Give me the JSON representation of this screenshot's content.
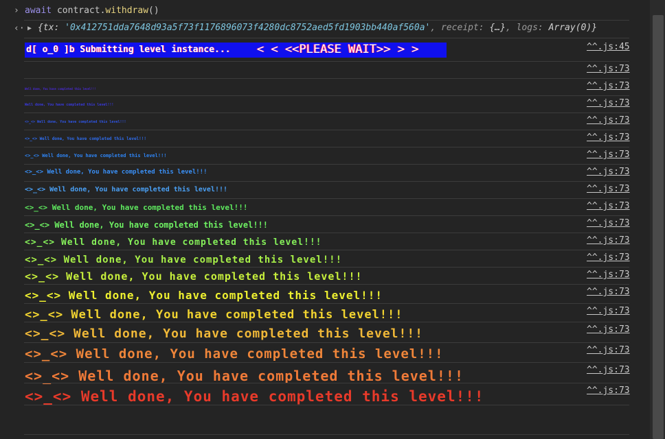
{
  "command": {
    "keyword": "await",
    "object": "contract",
    "method": "withdraw",
    "suffix": "()"
  },
  "result": {
    "open": "{tx: ",
    "tx": "'0x412751dda7648d93a5f73f1176896073f4280dc8752aed5fd1903bb440af560a'",
    "receipt_key": ", receipt: ",
    "receipt": "{…}",
    "logs_key": ", logs: ",
    "logs": "Array(0)",
    "close": "}"
  },
  "banner": {
    "left": "d[ o_0 ]b Submitting level instance...",
    "right": "<  < <<PLEASE WAIT>> >  >",
    "source": "^^.js:45"
  },
  "messages": [
    {
      "text": "",
      "source": "^^.js:73",
      "color": "#5a2ad0"
    },
    {
      "text": "Well done, You have completed this level!!!",
      "source": "^^.js:73",
      "color": "#4a2ad8"
    },
    {
      "text": "Well done, You have completed this level!!!",
      "source": "^^.js:73",
      "color": "#3a3ae0"
    },
    {
      "text": "<>_<> Well done, You have completed this level!!!",
      "source": "^^.js:73",
      "color": "#2f55e6"
    },
    {
      "text": "<>_<> Well done, You have completed this level!!!",
      "source": "^^.js:73",
      "color": "#2f6df0"
    },
    {
      "text": "<>_<> Well done, You have completed this level!!!",
      "source": "^^.js:73",
      "color": "#2f85f5"
    },
    {
      "text": "<>_<> Well done, You have completed this level!!!",
      "source": "^^.js:73",
      "color": "#3a8ff5"
    },
    {
      "text": "<>_<> Well done, You have completed this level!!!",
      "source": "^^.js:73",
      "color": "#4aa0f5"
    },
    {
      "text": "<>_<> Well done, You have completed this level!!!",
      "source": "^^.js:73",
      "color": "#5ee85e"
    },
    {
      "text": "<>_<> Well done, You have completed this level!!!",
      "source": "^^.js:73",
      "color": "#6ef062"
    },
    {
      "text": "<>_<> Well done, You have completed this level!!!",
      "source": "^^.js:73",
      "color": "#86f05a"
    },
    {
      "text": "<>_<> Well done, You have completed this level!!!",
      "source": "^^.js:73",
      "color": "#a8f048"
    },
    {
      "text": "<>_<> Well done, You have completed this level!!!",
      "source": "^^.js:73",
      "color": "#c8f03c"
    },
    {
      "text": "<>_<> Well done, You have completed this level!!!",
      "source": "^^.js:73",
      "color": "#eef030"
    },
    {
      "text": "<>_<> Well done, You have completed this level!!!",
      "source": "^^.js:73",
      "color": "#f2d430"
    },
    {
      "text": "<>_<> Well done, You have completed this level!!!",
      "source": "^^.js:73",
      "color": "#f0b838"
    },
    {
      "text": "<>_<> Well done, You have completed this level!!!",
      "source": "^^.js:73",
      "color": "#f0863a"
    },
    {
      "text": "<>_<> Well done, You have completed this level!!!",
      "source": "^^.js:73",
      "color": "#f07a38"
    },
    {
      "text": "<>_<> Well done, You have completed this level!!!",
      "source": "^^.js:73",
      "color": "#e83a2a"
    }
  ]
}
